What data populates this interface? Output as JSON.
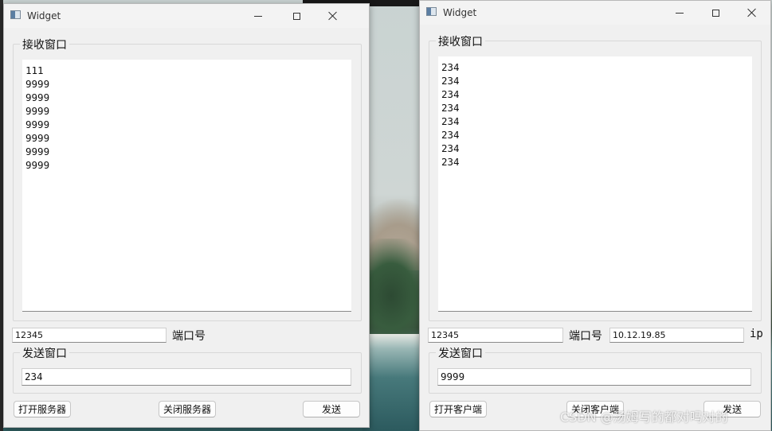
{
  "server_window": {
    "title": "Widget",
    "receive_group_title": "接收窗口",
    "receive_lines": [
      "111",
      "9999",
      "9999",
      "9999",
      "9999",
      "9999",
      "9999",
      "9999"
    ],
    "port_value": "12345",
    "port_label": "端口号",
    "send_group_title": "发送窗口",
    "send_value": "234",
    "open_button": "打开服务器",
    "close_button": "关闭服务器",
    "send_button": "发送"
  },
  "client_window": {
    "title": "Widget",
    "receive_group_title": "接收窗口",
    "receive_lines": [
      "234",
      "234",
      "234",
      "234",
      "234",
      "234",
      "234",
      "234"
    ],
    "port_value": "12345",
    "port_label": "端口号",
    "ip_value": "10.12.19.85",
    "ip_label": "ip",
    "send_group_title": "发送窗口",
    "send_value": "9999",
    "open_button": "打开客户端",
    "close_button": "关闭客户端",
    "send_button": "发送"
  },
  "watermark": "CSDN @汤姆写的都对吗对的"
}
